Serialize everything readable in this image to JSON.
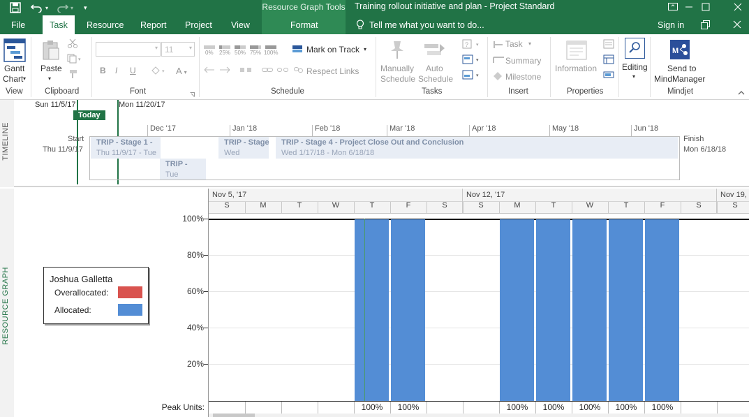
{
  "titlebar": {
    "context_tools_label": "Resource Graph Tools",
    "window_title": "Training rollout initiative and plan - Project Standard",
    "sign_in": "Sign in"
  },
  "tabs": [
    {
      "label": "File"
    },
    {
      "label": "Task"
    },
    {
      "label": "Resource"
    },
    {
      "label": "Report"
    },
    {
      "label": "Project"
    },
    {
      "label": "View"
    },
    {
      "label": "Format"
    }
  ],
  "tell_me": "Tell me what you want to do...",
  "ribbon": {
    "groups": {
      "view": "View",
      "clipboard": "Clipboard",
      "font": "Font",
      "schedule": "Schedule",
      "tasks": "Tasks",
      "insert": "Insert",
      "properties": "Properties",
      "mindjet": "Mindjet"
    },
    "gantt_chart": [
      "Gantt",
      "Chart"
    ],
    "paste": "Paste",
    "font_size": "11",
    "pct_labels": [
      "0%",
      "25%",
      "50%",
      "75%",
      "100%"
    ],
    "mark_on_track": "Mark on Track",
    "respect_links": "Respect Links",
    "manually": [
      "Manually",
      "Schedule"
    ],
    "auto": [
      "Auto",
      "Schedule"
    ],
    "task": "Task",
    "summary": "Summary",
    "milestone": "Milestone",
    "information": "Information",
    "editing": "Editing",
    "send_to": [
      "Send to",
      "MindManager"
    ]
  },
  "timeline": {
    "label": "TIMELINE",
    "date_left": "Sun 11/5/17",
    "date_right": "Mon 11/20/17",
    "today": "Today",
    "months": [
      "Dec '17",
      "Jan '18",
      "Feb '18",
      "Mar '18",
      "Apr '18",
      "May '18",
      "Jun '18"
    ],
    "start_label": "Start",
    "start_date": "Thu 11/9/17",
    "finish_label": "Finish",
    "finish_date": "Mon 6/18/18",
    "bars": [
      {
        "name": "TRIP - Stage 1 -",
        "dates": "Thu 11/9/17 - Tue"
      },
      {
        "name": "TRIP -",
        "dates": "Tue"
      },
      {
        "name": "TRIP - Stage",
        "dates": "Wed"
      },
      {
        "name": "TRIP - Stage 4 - Project Close Out and Conclusion",
        "dates": "Wed 1/17/18 - Mon 6/18/18"
      }
    ]
  },
  "resource_graph": {
    "label": "RESOURCE GRAPH",
    "legend": {
      "resource": "Joshua Galletta",
      "overallocated": "Overallocated:",
      "allocated": "Allocated:",
      "overallocated_color": "#d9534f",
      "allocated_color": "#538dd5"
    },
    "week_labels": [
      "Nov 5, '17",
      "Nov 12, '17",
      "Nov 19,"
    ],
    "days": [
      "S",
      "M",
      "T",
      "W",
      "T",
      "F",
      "S",
      "S",
      "M",
      "T",
      "W",
      "T",
      "F",
      "S",
      "S"
    ],
    "y_ticks": [
      "100%",
      "80%",
      "60%",
      "40%",
      "20%"
    ],
    "peak_units_label": "Peak Units:",
    "peak_units": [
      "",
      "",
      "",
      "",
      "100%",
      "100%",
      "",
      "",
      "100%",
      "100%",
      "100%",
      "100%",
      "100%",
      "",
      ""
    ],
    "allocation": [
      0,
      0,
      0,
      0,
      1,
      1,
      0,
      0,
      1,
      1,
      1,
      1,
      1,
      0,
      0
    ]
  }
}
